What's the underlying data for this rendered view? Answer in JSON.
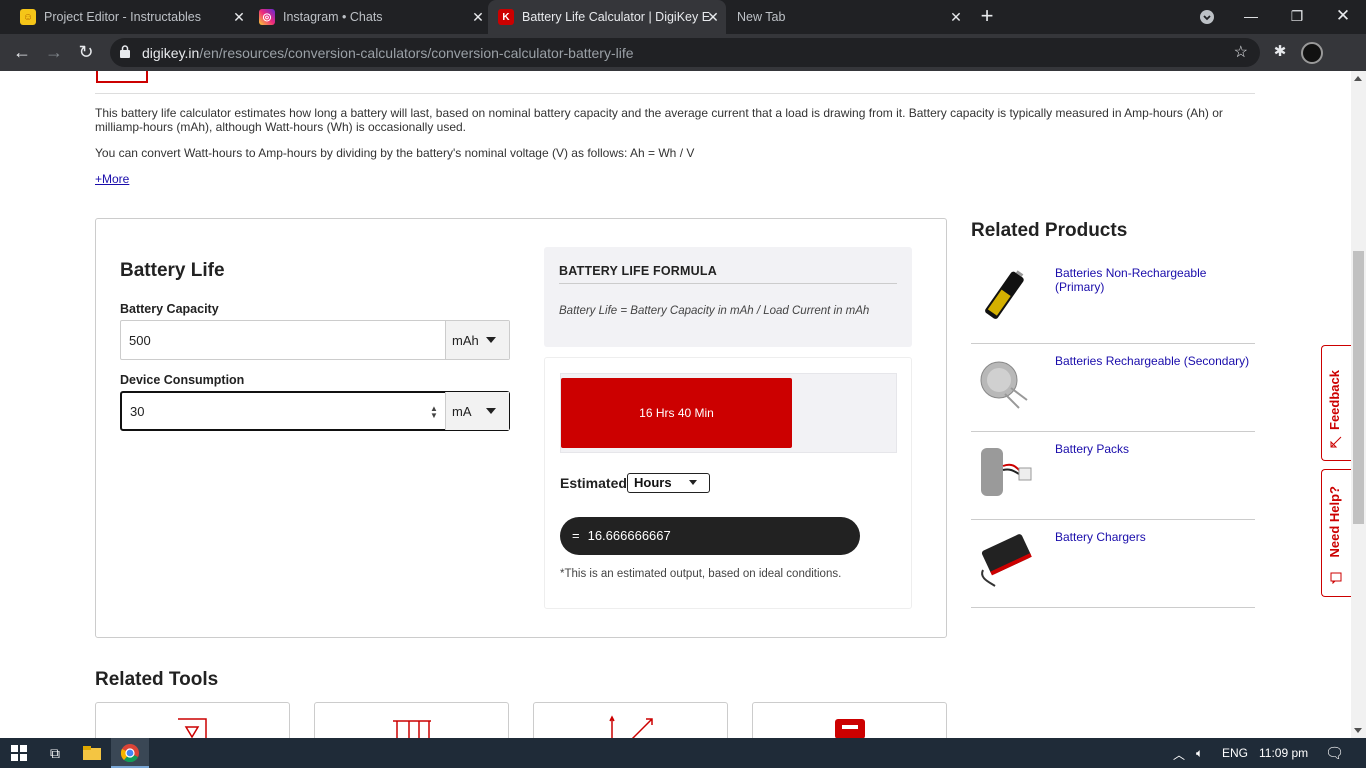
{
  "browser": {
    "tabs": [
      {
        "title": "Project Editor - Instructables",
        "icon": "instructables-favicon"
      },
      {
        "title": "Instagram • Chats",
        "icon": "instagram-favicon"
      },
      {
        "title": "Battery Life Calculator | DigiKey E",
        "icon": "digikey-favicon",
        "active": true
      },
      {
        "title": "New Tab",
        "icon": ""
      }
    ],
    "url_host": "digikey.in",
    "url_path": "/en/resources/conversion-calculators/conversion-calculator-battery-life"
  },
  "intro": {
    "paragraph1": "This battery life calculator estimates how long a battery will last, based on nominal battery capacity and the average current that a load is drawing from it. Battery capacity is typically measured in Amp-hours (Ah) or milliamp-hours (mAh), although Watt-hours (Wh) is occasionally used.",
    "paragraph2": "You can convert Watt-hours to Amp-hours by dividing by the battery's nominal voltage (V) as follows: Ah = Wh / V",
    "more_link": "+More"
  },
  "calculator": {
    "title": "Battery Life",
    "capacity_label": "Battery Capacity",
    "capacity_value": "500",
    "capacity_unit": "mAh",
    "consumption_label": "Device Consumption",
    "consumption_value": "30",
    "consumption_unit": "mA",
    "formula_heading": "BATTERY LIFE FORMULA",
    "formula_text": "Battery Life = Battery Capacity in mAh / Load Current in mAh",
    "bar_text": "16 Hrs 40 Min",
    "bar_fill_fraction": 0.69,
    "estimated_label": "Estimated",
    "estimated_unit": "Hours",
    "result_eq": "=",
    "result_value": "16.666666667",
    "note": "*This is an estimated output, based on ideal conditions."
  },
  "related_products": {
    "title": "Related Products",
    "items": [
      {
        "label": "Batteries Non-Rechargeable (Primary)",
        "image": "aa-battery-image"
      },
      {
        "label": "Batteries Rechargeable (Secondary)",
        "image": "coin-cell-image"
      },
      {
        "label": "Battery Packs",
        "image": "battery-pack-image"
      },
      {
        "label": "Battery Chargers",
        "image": "battery-charger-image"
      }
    ]
  },
  "side_tabs": {
    "feedback": "Feedback",
    "help": "Need Help?"
  },
  "related_tools": {
    "title": "Related Tools"
  },
  "taskbar": {
    "lang": "ENG",
    "time": "11:09 pm"
  },
  "colors": {
    "accent": "#cc0000",
    "link": "#1a0dab",
    "chrome_dark": "#202124"
  }
}
